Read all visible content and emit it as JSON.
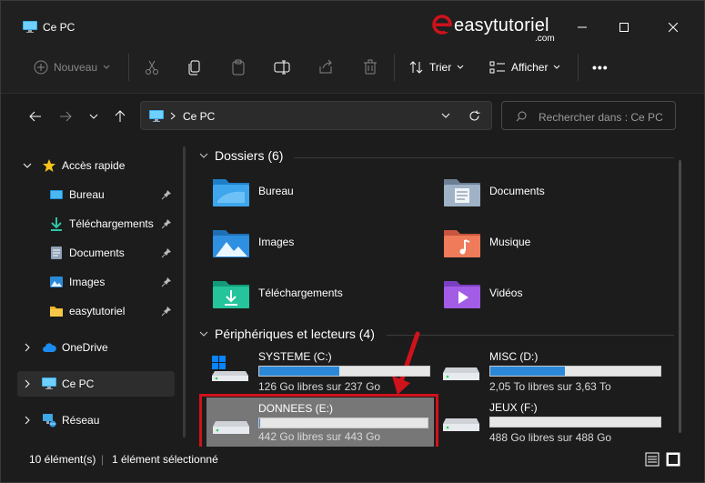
{
  "window": {
    "title": "Ce PC"
  },
  "brand": {
    "name": "easytutoriel",
    "tld": ".com",
    "accent": "#d0121b"
  },
  "toolbar": {
    "new_label": "Nouveau",
    "sort_label": "Trier",
    "view_label": "Afficher",
    "more_label": "•••"
  },
  "address": {
    "path": "Ce PC",
    "search_placeholder": "Rechercher dans : Ce PC"
  },
  "sidebar": {
    "quick_access": "Accès rapide",
    "items": [
      {
        "label": "Bureau",
        "icon": "desktop-icon"
      },
      {
        "label": "Téléchargements",
        "icon": "download-icon"
      },
      {
        "label": "Documents",
        "icon": "document-icon"
      },
      {
        "label": "Images",
        "icon": "image-icon"
      },
      {
        "label": "easytutoriel",
        "icon": "folder-icon"
      }
    ],
    "onedrive": "OneDrive",
    "this_pc": "Ce PC",
    "network": "Réseau"
  },
  "folders": {
    "title": "Dossiers (6)",
    "items": [
      {
        "label": "Bureau",
        "icon": "desktop-folder-icon"
      },
      {
        "label": "Documents",
        "icon": "documents-folder-icon"
      },
      {
        "label": "Images",
        "icon": "pictures-folder-icon"
      },
      {
        "label": "Musique",
        "icon": "music-folder-icon"
      },
      {
        "label": "Téléchargements",
        "icon": "downloads-folder-icon"
      },
      {
        "label": "Vidéos",
        "icon": "videos-folder-icon"
      }
    ]
  },
  "drives": {
    "title": "Périphériques et lecteurs (4)",
    "items": [
      {
        "name": "SYSTEME (C:)",
        "free": "126 Go libres sur 237 Go",
        "used_fraction": 0.47,
        "system": true
      },
      {
        "name": "MISC (D:)",
        "free": "2,05 To libres sur 3,63 To",
        "used_fraction": 0.44,
        "system": false
      },
      {
        "name": "DONNEES (E:)",
        "free": "442 Go libres sur 443 Go",
        "used_fraction": 0.002,
        "system": false
      },
      {
        "name": "JEUX (F:)",
        "free": "488 Go libres sur 488 Go",
        "used_fraction": 0.0,
        "system": false
      }
    ]
  },
  "status": {
    "count": "10 élément(s)",
    "selection": "1 élément sélectionné"
  }
}
